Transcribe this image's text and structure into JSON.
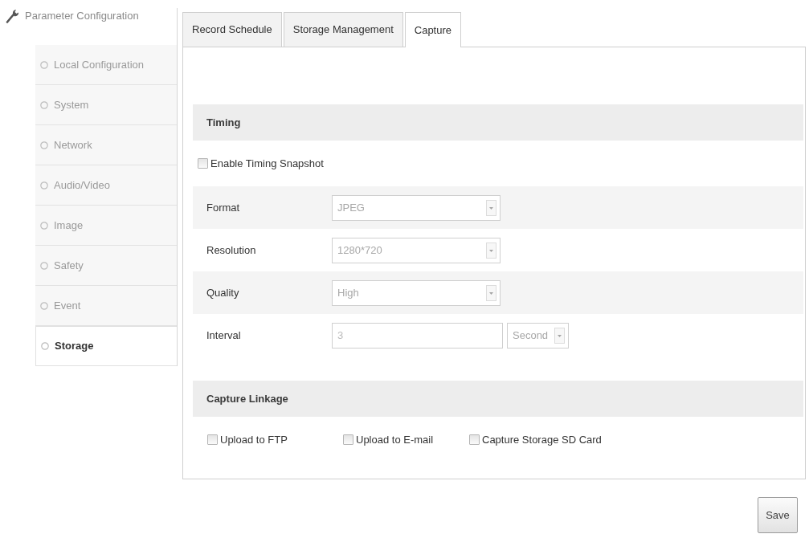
{
  "sidebar": {
    "title": "Parameter Configuration",
    "items": [
      {
        "label": "Local Configuration",
        "selected": false
      },
      {
        "label": "System",
        "selected": false
      },
      {
        "label": "Network",
        "selected": false
      },
      {
        "label": "Audio/Video",
        "selected": false
      },
      {
        "label": "Image",
        "selected": false
      },
      {
        "label": "Safety",
        "selected": false
      },
      {
        "label": "Event",
        "selected": false
      },
      {
        "label": "Storage",
        "selected": true
      }
    ]
  },
  "tabs": [
    {
      "label": "Record Schedule",
      "selected": false
    },
    {
      "label": "Storage Management",
      "selected": false
    },
    {
      "label": "Capture",
      "selected": true
    }
  ],
  "timing": {
    "title": "Timing",
    "enable": {
      "label": "Enable Timing Snapshot",
      "checked": false
    },
    "fields": [
      {
        "label": "Format",
        "kind": "dropdown",
        "value": "JPEG",
        "disabled": true
      },
      {
        "label": "Resolution",
        "kind": "dropdown",
        "value": "1280*720",
        "disabled": true
      },
      {
        "label": "Quality",
        "kind": "dropdown",
        "value": "High",
        "disabled": true
      },
      {
        "label": "Interval",
        "kind": "input",
        "value": "3",
        "unit": "Second",
        "disabled": true
      }
    ]
  },
  "capture_linkage": {
    "title": "Capture Linkage",
    "options": [
      {
        "label": "Upload to FTP",
        "checked": false
      },
      {
        "label": "Upload to E-mail",
        "checked": false
      },
      {
        "label": "Capture Storage SD Card",
        "checked": false
      }
    ]
  },
  "save_button": "Save"
}
